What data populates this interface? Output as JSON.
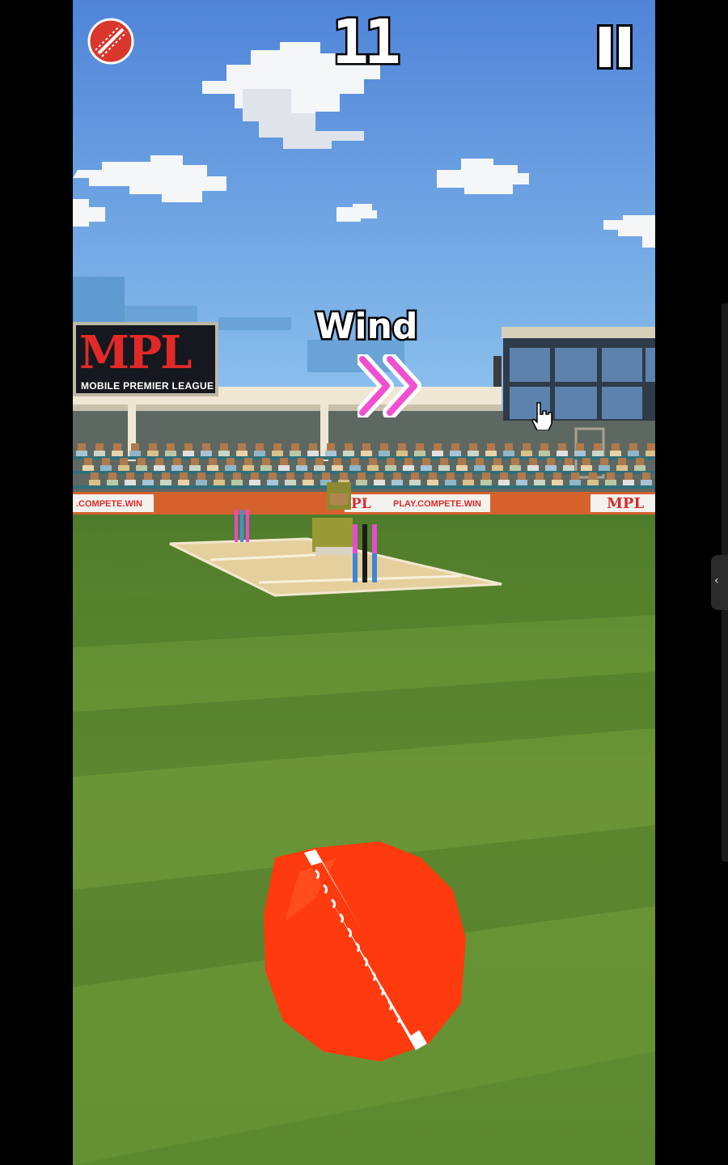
{
  "hud": {
    "score": "11",
    "menu_icon": "cricket-ball-icon",
    "pause_icon": "pause-icon"
  },
  "wind": {
    "label": "Wind",
    "direction_icon": "double-chevron-right-icon",
    "color": "#f24fd0"
  },
  "stadium": {
    "board_logo": "MPL",
    "board_subtitle": "MOBILE PREMIER LEAGUE",
    "ad_left": ".COMPETE.WIN",
    "ad_mid_logo": "PL",
    "ad_mid_url": "PLAY.COMPETE.WIN",
    "ad_right_logo": "MPL"
  },
  "colors": {
    "sky": "#5a8ad6",
    "grass": "#6a8f2f",
    "ball": "#ff3a0e",
    "brand_red": "#e12a28"
  },
  "system": {
    "sidebar_handle_icon": "chevron-left-icon",
    "cursor_icon": "hand-pointer-icon"
  }
}
